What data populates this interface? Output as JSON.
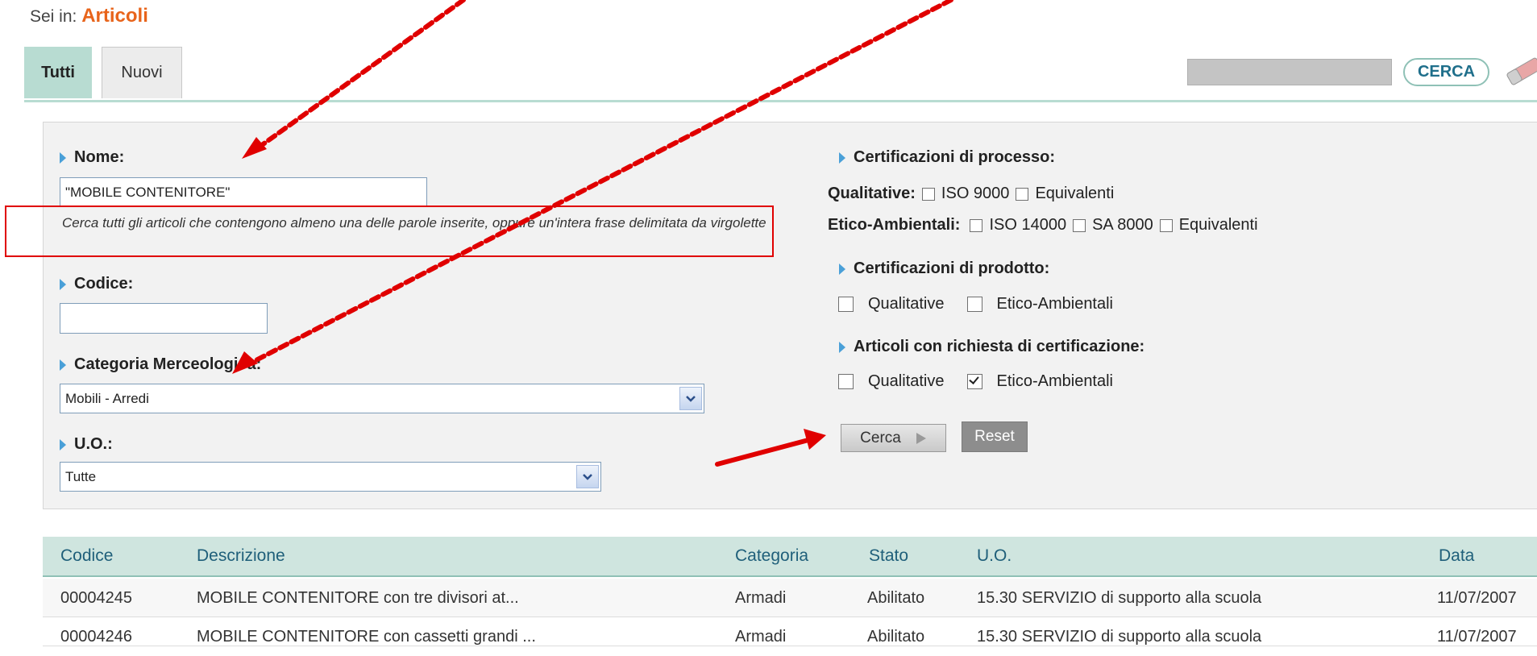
{
  "breadcrumb": {
    "prefix": "Sei in:",
    "current": "Articoli"
  },
  "tabs": [
    {
      "label": "Tutti"
    },
    {
      "label": "Nuovi"
    }
  ],
  "top_search": {
    "value": "",
    "button_label": "CERCA"
  },
  "form": {
    "nome": {
      "label": "Nome:",
      "value": "\"MOBILE CONTENITORE\"",
      "hint": "Cerca tutti gli articoli che contengono almeno una delle parole inserite, oppure un'intera frase delimitata da virgolette"
    },
    "codice": {
      "label": "Codice:",
      "value": ""
    },
    "categoria": {
      "label": "Categoria Merceologica:",
      "selected": "Mobili - Arredi"
    },
    "uo": {
      "label": "U.O.:",
      "selected": "Tutte"
    }
  },
  "cert_processo": {
    "title": "Certificazioni di processo:",
    "qualitative": {
      "label": "Qualitative:",
      "options": [
        {
          "label": "ISO 9000",
          "checked": false
        },
        {
          "label": "Equivalenti",
          "checked": false
        }
      ]
    },
    "etico": {
      "label": "Etico-Ambientali:",
      "options": [
        {
          "label": "ISO 14000",
          "checked": false
        },
        {
          "label": "SA 8000",
          "checked": false
        },
        {
          "label": "Equivalenti",
          "checked": false
        }
      ]
    }
  },
  "cert_prodotto": {
    "title": "Certificazioni di prodotto:",
    "options": [
      {
        "label": "Qualitative",
        "checked": false
      },
      {
        "label": "Etico-Ambientali",
        "checked": false
      }
    ]
  },
  "cert_richiesta": {
    "title": "Articoli con richiesta di certificazione:",
    "options": [
      {
        "label": "Qualitative",
        "checked": false
      },
      {
        "label": "Etico-Ambientali",
        "checked": true
      }
    ]
  },
  "buttons": {
    "cerca": "Cerca",
    "reset": "Reset"
  },
  "table": {
    "columns": [
      "Codice",
      "Descrizione",
      "Categoria",
      "Stato",
      "U.O.",
      "Data"
    ],
    "rows": [
      {
        "codice": "00004245",
        "descrizione": "MOBILE CONTENITORE con tre divisori at...",
        "categoria": "Armadi",
        "stato": "Abilitato",
        "uo": "15.30 SERVIZIO di supporto alla scuola",
        "data": "11/07/2007"
      },
      {
        "codice": "00004246",
        "descrizione": "MOBILE CONTENITORE con cassetti grandi ...",
        "categoria": "Armadi",
        "stato": "Abilitato",
        "uo": "15.30 SERVIZIO di supporto alla scuola",
        "data": "11/07/2007"
      }
    ]
  },
  "colors": {
    "accent_orange": "#e8641b",
    "tab_green": "#b8dcd2",
    "header_text": "#1f5f7a",
    "annotation_red": "#e00000"
  }
}
